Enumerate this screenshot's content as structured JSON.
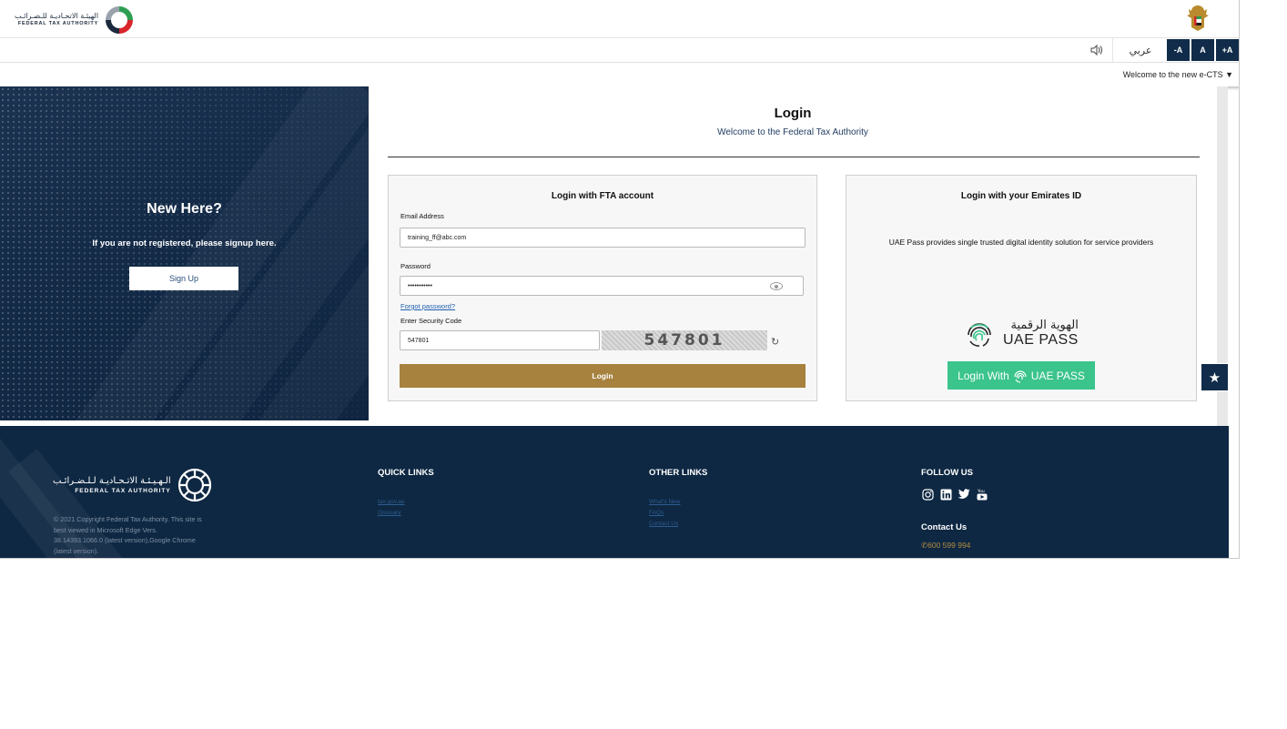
{
  "header": {
    "logo_ar": "الهيئـة الاتحـاديـة للـضـرائـب",
    "logo_en": "FEDERAL TAX AUTHORITY",
    "speaker_icon": "speaker-icon",
    "language_toggle": "عربي",
    "font_decrease": "-A",
    "font_reset": "A",
    "font_increase": "+A",
    "welcome_text": "Welcome to the new e-CTS ▼"
  },
  "hero": {
    "title": "New Here?",
    "subtitle": "If you are not registered, please signup here.",
    "signup_label": "Sign Up"
  },
  "login": {
    "title": "Login",
    "subtitle": "Welcome to the Federal Tax Authority",
    "fta": {
      "title": "Login with FTA account",
      "email_label": "Email Address",
      "email_value": "training_ff@abc.com",
      "password_label": "Password",
      "password_value": "•••••••••••",
      "forgot_label": "Forgot password?",
      "security_label": "Enter Security Code",
      "security_value": "547801",
      "captcha_text": "547801",
      "refresh_icon": "↻",
      "login_label": "Login"
    },
    "eid": {
      "title": "Login with your Emirates ID",
      "description": "UAE Pass provides single trusted digital identity solution for service providers",
      "uaepass_ar": "الهوية الرقمية",
      "uaepass_en": "UAE PASS",
      "button_prefix": "Login With",
      "button_brand": "UAE PASS"
    }
  },
  "favorite_icon": "★",
  "footer": {
    "logo_ar": "الـهـيـئـة الاتـحـاديـة لـلـضـرائـب",
    "logo_en": "FEDERAL TAX AUTHORITY",
    "copyright": "© 2021 Copyright Federal Tax Authority. This site is best viewed in Microsoft Edge Vers. 38.14393.1066.0 (latest version),Google Chrome (latest version).",
    "quick_links_title": "QUICK LINKS",
    "quick_links": [
      "tax.gov.ae",
      "Glossary"
    ],
    "other_links_title": "OTHER LINKS",
    "other_links": [
      "What's New",
      "FAQs",
      "Contact Us"
    ],
    "follow_title": "FOLLOW US",
    "social": [
      "instagram-icon",
      "linkedin-icon",
      "twitter-icon",
      "youtube-icon"
    ],
    "contact_title": "Contact Us",
    "phone": "600 599 994"
  },
  "colors": {
    "navy": "#112c4a",
    "gold": "#a6823e",
    "uaepass_green": "#3bc48c"
  }
}
